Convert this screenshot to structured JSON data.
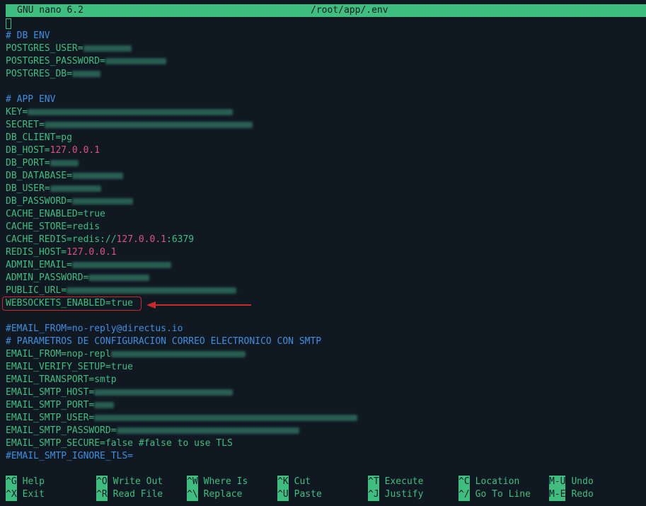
{
  "titlebar": {
    "app": "GNU nano 6.2",
    "file": "/root/app/.env"
  },
  "lines": [
    {
      "type": "comment",
      "text": "# DB ENV"
    },
    {
      "type": "kv",
      "key": "POSTGRES_USER=",
      "blur": 68
    },
    {
      "type": "kv",
      "key": "POSTGRES_PASSWORD=",
      "blur": 86
    },
    {
      "type": "kv",
      "key": "POSTGRES_DB=",
      "blur": 40
    },
    {
      "type": "blank"
    },
    {
      "type": "comment",
      "text": "# APP ENV"
    },
    {
      "type": "kv",
      "key": "KEY=",
      "blur": 290
    },
    {
      "type": "kv",
      "key": "SECRET=",
      "blur": 294
    },
    {
      "type": "plain",
      "text": "DB_CLIENT=pg"
    },
    {
      "type": "host",
      "key": "DB_HOST=",
      "value": "127.0.0.1"
    },
    {
      "type": "kv",
      "key": "DB_PORT=",
      "blur": 40
    },
    {
      "type": "kv",
      "key": "DB_DATABASE=",
      "blur": 72
    },
    {
      "type": "kv",
      "key": "DB_USER=",
      "blur": 72
    },
    {
      "type": "kv",
      "key": "DB_PASSWORD=",
      "blur": 86
    },
    {
      "type": "plain",
      "text": "CACHE_ENABLED=true"
    },
    {
      "type": "plain",
      "text": "CACHE_STORE=redis"
    },
    {
      "type": "redis",
      "key": "CACHE_REDIS=redis://",
      "value": "127.0.0.1",
      "suffix": ":6379"
    },
    {
      "type": "host",
      "key": "REDIS_HOST=",
      "value": "127.0.0.1"
    },
    {
      "type": "kv",
      "key": "ADMIN_EMAIL=",
      "blur": 140
    },
    {
      "type": "kv",
      "key": "ADMIN_PASSWORD=",
      "blur": 86
    },
    {
      "type": "kv",
      "key": "PUBLIC_URL=",
      "blur": 240
    },
    {
      "type": "plain",
      "text": "WEBSOCKETS_ENABLED=true"
    },
    {
      "type": "blank"
    },
    {
      "type": "comment",
      "text": "#EMAIL_FROM=no-reply@directus.io"
    },
    {
      "type": "comment",
      "text": "# PARAMETROS DE CONFIGURACION CORREO ELECTRONICO CON SMTP"
    },
    {
      "type": "kv",
      "key": "EMAIL_FROM=nop-repl",
      "blur": 190
    },
    {
      "type": "plain",
      "text": "EMAIL_VERIFY_SETUP=true"
    },
    {
      "type": "plain",
      "text": "EMAIL_TRANSPORT=smtp"
    },
    {
      "type": "kv",
      "key": "EMAIL_SMTP_HOST=",
      "blur": 196
    },
    {
      "type": "kv",
      "key": "EMAIL_SMTP_PORT=",
      "blur": 28
    },
    {
      "type": "kv",
      "key": "EMAIL_SMTP_USER=",
      "blur": 372
    },
    {
      "type": "kv",
      "key": "EMAIL_SMTP_PASSWORD=",
      "blur": 258
    },
    {
      "type": "plain",
      "text": "EMAIL_SMTP_SECURE=false #false to use TLS"
    },
    {
      "type": "comment",
      "text": "#EMAIL_SMTP_IGNORE_TLS="
    }
  ],
  "shortcuts": [
    {
      "key": "^G",
      "label": "Help",
      "row": 0,
      "col": 0
    },
    {
      "key": "^X",
      "label": "Exit",
      "row": 1,
      "col": 0
    },
    {
      "key": "^O",
      "label": "Write Out",
      "row": 0,
      "col": 1
    },
    {
      "key": "^R",
      "label": "Read File",
      "row": 1,
      "col": 1
    },
    {
      "key": "^W",
      "label": "Where Is",
      "row": 0,
      "col": 2
    },
    {
      "key": "^\\",
      "label": "Replace",
      "row": 1,
      "col": 2
    },
    {
      "key": "^K",
      "label": "Cut",
      "row": 0,
      "col": 3
    },
    {
      "key": "^U",
      "label": "Paste",
      "row": 1,
      "col": 3
    },
    {
      "key": "^T",
      "label": "Execute",
      "row": 0,
      "col": 4
    },
    {
      "key": "^J",
      "label": "Justify",
      "row": 1,
      "col": 4
    },
    {
      "key": "^C",
      "label": "Location",
      "row": 0,
      "col": 5
    },
    {
      "key": "^/",
      "label": "Go To Line",
      "row": 1,
      "col": 5
    },
    {
      "key": "M-U",
      "label": "Undo",
      "row": 0,
      "col": 6
    },
    {
      "key": "M-E",
      "label": "Redo",
      "row": 1,
      "col": 6
    }
  ]
}
